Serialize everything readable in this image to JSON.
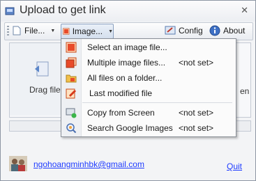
{
  "window": {
    "title": "Upload to get link",
    "close_glyph": "✕"
  },
  "toolbar": {
    "file_label": "File...",
    "image_label": "Image...",
    "config_label": "Config",
    "about_label": "About"
  },
  "content": {
    "drag_label": "Drag file",
    "right_fragment": "en"
  },
  "menu": {
    "items": [
      {
        "label": "Select an image file...",
        "value": ""
      },
      {
        "label": "Multiple image files...",
        "value": "<not set>"
      },
      {
        "label": "All files on a folder...",
        "value": ""
      },
      {
        "label": "Last modified file",
        "value": ""
      },
      {
        "label": "Copy from Screen",
        "value": "<not set>"
      },
      {
        "label": "Search Google Images",
        "value": "<not set>"
      }
    ]
  },
  "footer": {
    "email": "ngohoangminhbk@gmail.com",
    "quit": "Quit"
  },
  "colors": {
    "link": "#1f3cff",
    "menu_border": "#8a8f97",
    "toolbar_pressed": "#d4dfee"
  }
}
